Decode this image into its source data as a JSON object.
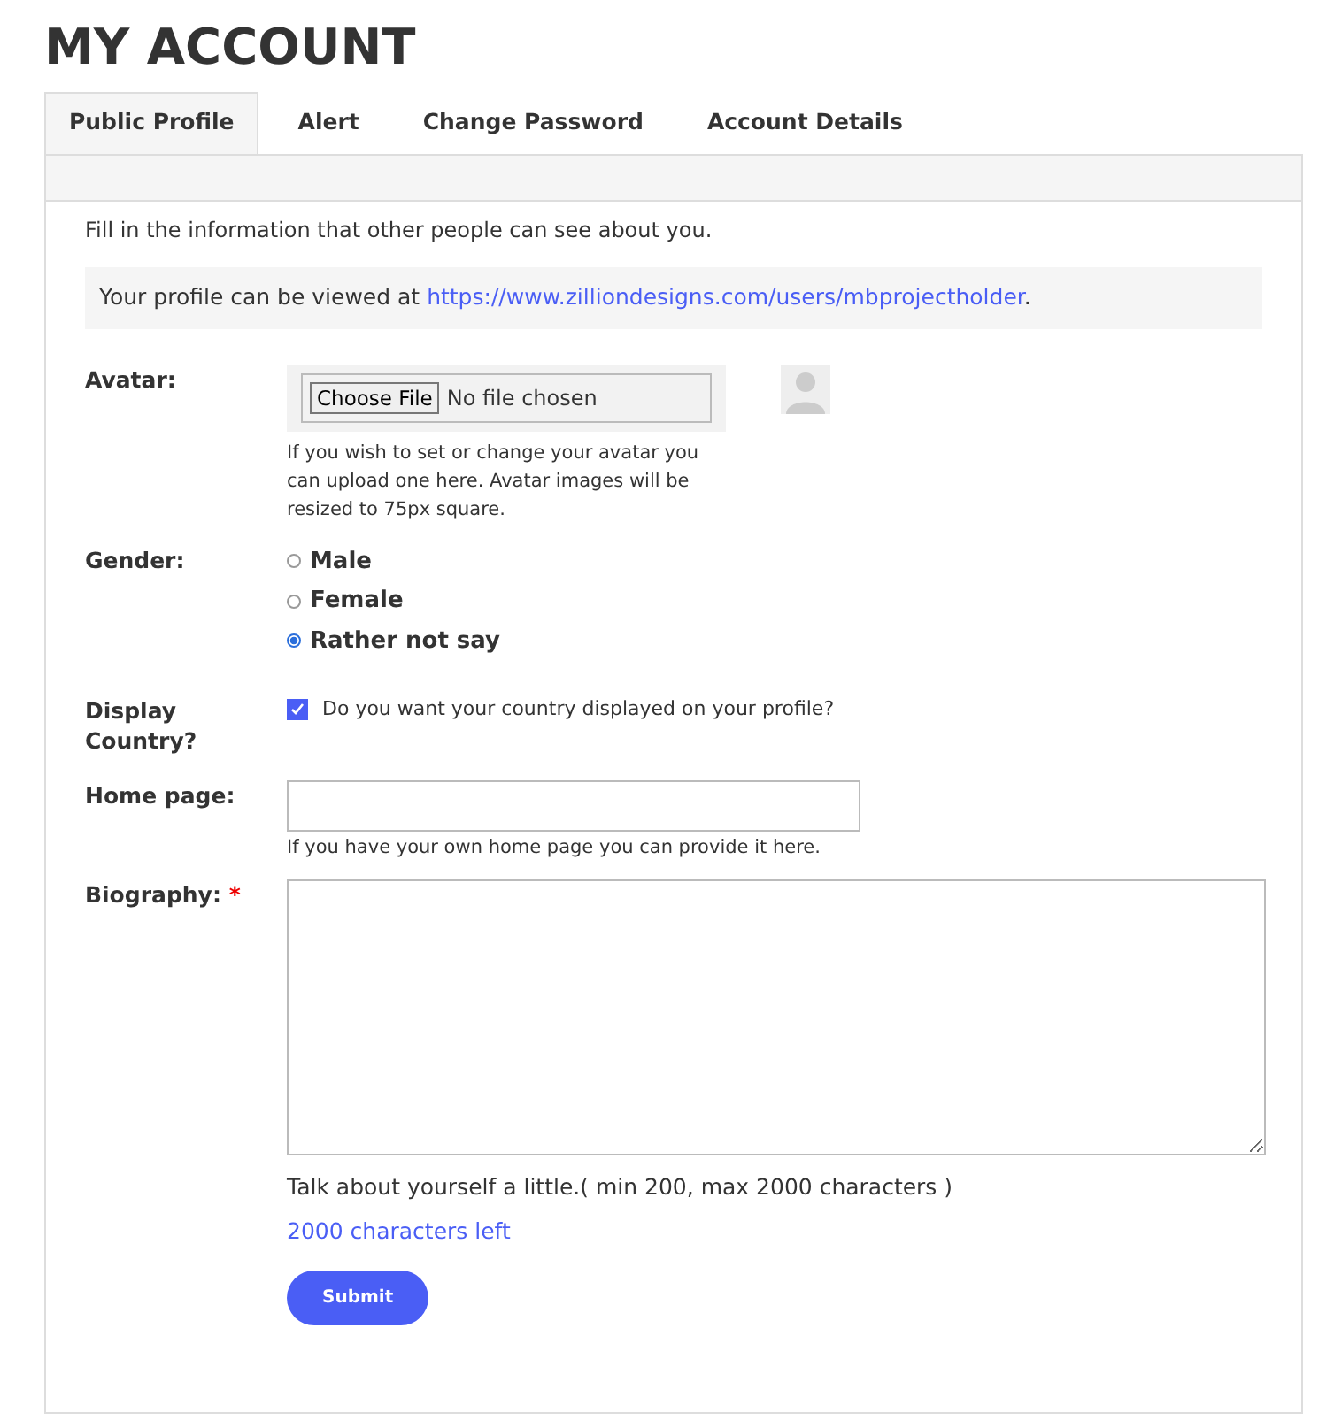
{
  "title": "MY ACCOUNT",
  "tabs": [
    {
      "label": "Public Profile",
      "selected": true
    },
    {
      "label": "Alert",
      "selected": false
    },
    {
      "label": "Change Password",
      "selected": false
    },
    {
      "label": "Account Details",
      "selected": false
    }
  ],
  "intro": "Fill in the information that other people can see about you.",
  "profile_link": {
    "prefix": "Your profile can be viewed at ",
    "url": "https://www.zilliondesigns.com/users/mbprojectholder",
    "suffix": "."
  },
  "avatar": {
    "label": "Avatar:",
    "button": "Choose File",
    "status": "No file chosen",
    "help": "If you wish to set or change your avatar you can upload one here. Avatar images will be resized to 75px square."
  },
  "gender": {
    "label": "Gender:",
    "options": [
      {
        "label": "Male",
        "selected": false
      },
      {
        "label": "Female",
        "selected": false
      },
      {
        "label": "Rather not say",
        "selected": true
      }
    ]
  },
  "display_country": {
    "label": "Display Country?",
    "checked": true,
    "text": "Do you want your country displayed on your profile?"
  },
  "home_page": {
    "label": "Home page:",
    "help": "If you have your own home page you can provide it here."
  },
  "biography": {
    "label": "Biography:",
    "required_mark": "*",
    "help": "Talk about yourself a little.( min 200, max 2000 characters )",
    "counter": "2000 characters left"
  },
  "submit": "Submit"
}
